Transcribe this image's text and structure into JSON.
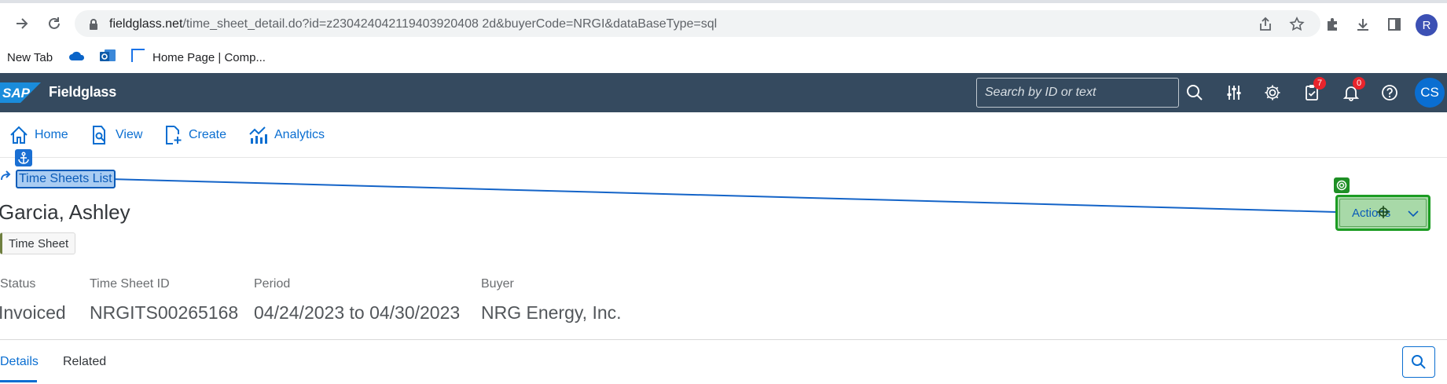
{
  "browser": {
    "url_host": "fieldglass.net",
    "url_rest": "/time_sheet_detail.do?id=z230424042119403920408 2d&buyerCode=NRGI&dataBaseType=sql",
    "profile_initial": "R"
  },
  "bookmarks": [
    {
      "label": "New Tab"
    },
    {
      "label": ""
    },
    {
      "label": ""
    },
    {
      "label": "Home Page | Comp..."
    }
  ],
  "shell": {
    "product_name": "Fieldglass",
    "search_placeholder": "Search by ID or text",
    "tasks_count": "7",
    "notifications_count": "0",
    "user_initials": "CS"
  },
  "nav": {
    "home": "Home",
    "view": "View",
    "create": "Create",
    "analytics": "Analytics"
  },
  "header": {
    "breadcrumb": "Time Sheets List",
    "title": "Garcia, Ashley",
    "tag": "Time Sheet",
    "actions_label": "Actions",
    "attributes": [
      {
        "label": "Status",
        "value": "Invoiced"
      },
      {
        "label": "Time Sheet ID",
        "value": "NRGITS00265168"
      },
      {
        "label": "Period",
        "value": "04/24/2023 to 04/30/2023"
      },
      {
        "label": "Buyer",
        "value": "NRG Energy, Inc."
      }
    ]
  },
  "tabs": {
    "details": "Details",
    "related": "Related"
  },
  "colors": {
    "shell_bg": "#354a5f",
    "link_blue": "#0a6ed1",
    "badge_red": "#e9242c",
    "target_green": "#1c9c23"
  }
}
